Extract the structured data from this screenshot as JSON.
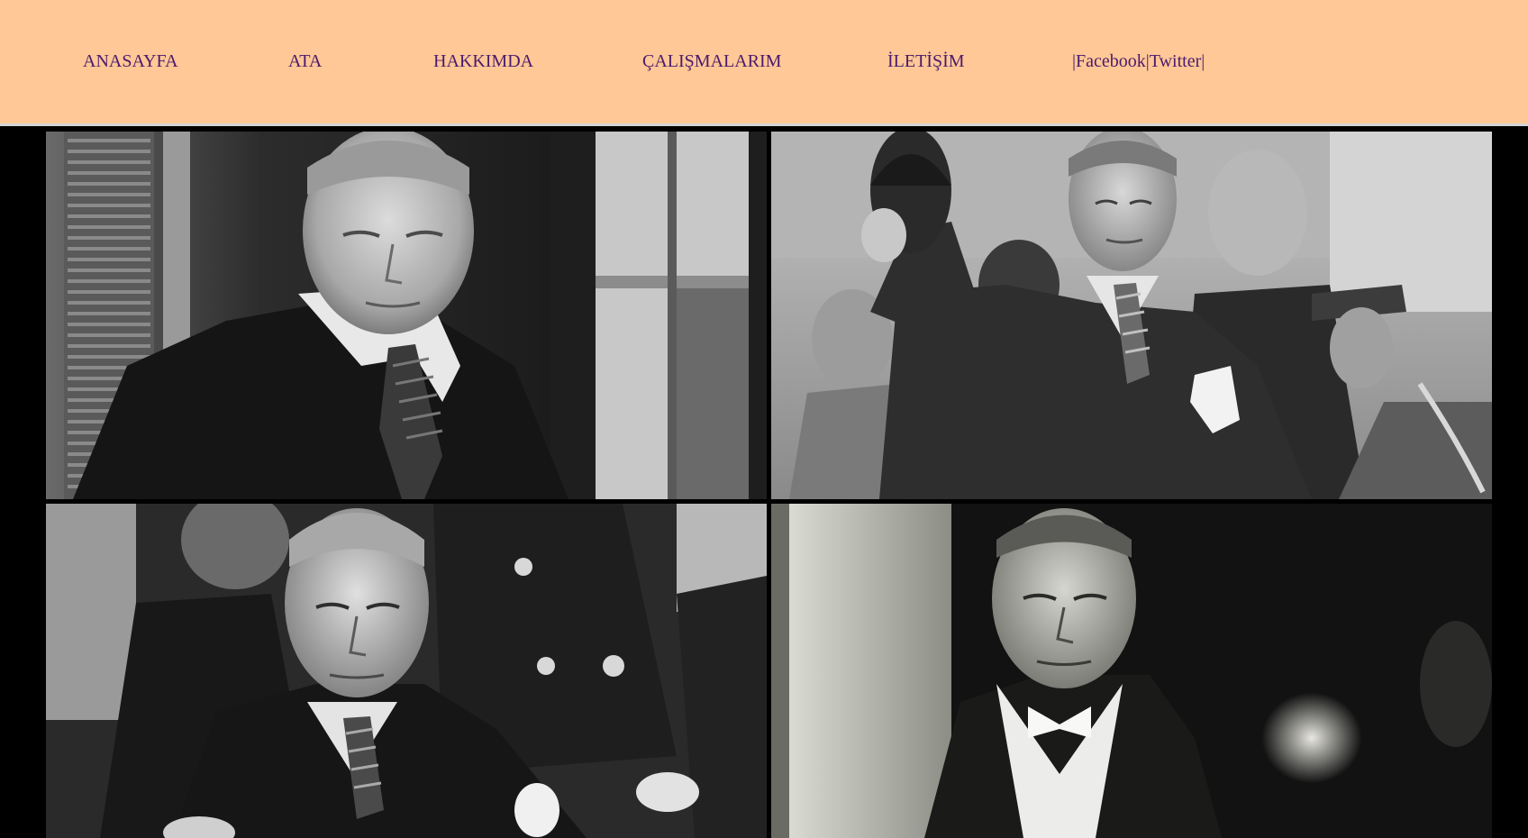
{
  "nav": {
    "items": [
      {
        "label": "ANASAYFA"
      },
      {
        "label": "ATA"
      },
      {
        "label": "HAKKIMDA"
      },
      {
        "label": "ÇALIŞMALARIM"
      },
      {
        "label": "İLETİŞİM"
      }
    ],
    "social": {
      "sep_open": "|",
      "facebook": "Facebook",
      "sep_mid": "|",
      "twitter": "Twitter",
      "sep_close": "|"
    }
  },
  "colors": {
    "nav_background": "#ffc896",
    "nav_text": "#4b1a6e",
    "page_background": "#000000"
  },
  "gallery": {
    "photos": [
      {
        "subject": "portrait-looking-down"
      },
      {
        "subject": "portrait-raising-hat"
      },
      {
        "subject": "portrait-seated-crowd"
      },
      {
        "subject": "portrait-close-up"
      }
    ]
  }
}
